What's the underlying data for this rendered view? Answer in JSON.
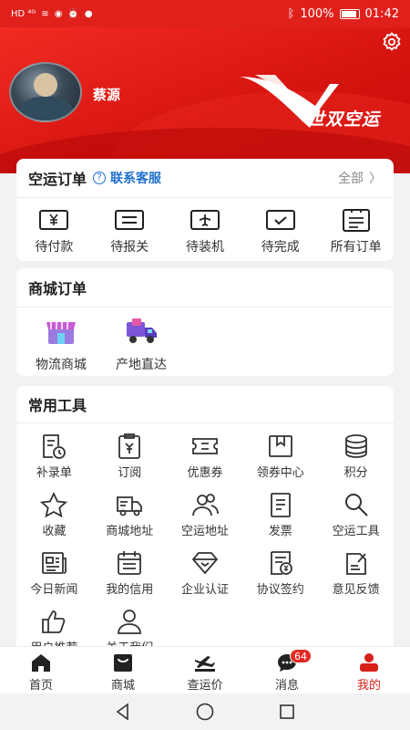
{
  "status_bar": {
    "left_icons": "HD ⁴ᴳ",
    "battery": "100%",
    "time": "01:42"
  },
  "profile": {
    "username": "蔡源",
    "brand_name": "世双空运"
  },
  "air_orders": {
    "title": "空运订单",
    "help_icon": "?",
    "service_link": "联系客服",
    "all_link": "全部",
    "items": [
      {
        "label": "待付款",
        "icon": "yen-card-icon"
      },
      {
        "label": "待报关",
        "icon": "document-icon"
      },
      {
        "label": "待装机",
        "icon": "plane-icon"
      },
      {
        "label": "待完成",
        "icon": "check-box-icon"
      },
      {
        "label": "所有订单",
        "icon": "list-icon"
      }
    ]
  },
  "mall_orders": {
    "title": "商城订单",
    "items": [
      {
        "label": "物流商城",
        "icon": "store-icon"
      },
      {
        "label": "产地直达",
        "icon": "truck-icon"
      }
    ]
  },
  "tools": {
    "title": "常用工具",
    "items": [
      {
        "label": "补录单",
        "icon": "form-clock-icon"
      },
      {
        "label": "订阅",
        "icon": "clipboard-yen-icon"
      },
      {
        "label": "优惠券",
        "icon": "coupon-icon"
      },
      {
        "label": "领券中心",
        "icon": "box-icon"
      },
      {
        "label": "积分",
        "icon": "coins-icon"
      },
      {
        "label": "收藏",
        "icon": "star-icon"
      },
      {
        "label": "商城地址",
        "icon": "truck-outline-icon"
      },
      {
        "label": "空运地址",
        "icon": "people-icon"
      },
      {
        "label": "发票",
        "icon": "invoice-icon"
      },
      {
        "label": "空运工具",
        "icon": "search-icon"
      },
      {
        "label": "今日新闻",
        "icon": "news-icon"
      },
      {
        "label": "我的信用",
        "icon": "calendar-icon"
      },
      {
        "label": "企业认证",
        "icon": "diamond-icon"
      },
      {
        "label": "协议签约",
        "icon": "contract-icon"
      },
      {
        "label": "意见反馈",
        "icon": "feedback-icon"
      },
      {
        "label": "用户推荐",
        "icon": "thumbs-up-icon"
      },
      {
        "label": "关于我们",
        "icon": "user-icon"
      }
    ]
  },
  "tab_bar": {
    "items": [
      {
        "label": "首页",
        "icon": "home-icon"
      },
      {
        "label": "商城",
        "icon": "shopping-bag-icon"
      },
      {
        "label": "查运价",
        "icon": "airplane-freight-icon"
      },
      {
        "label": "消息",
        "icon": "chat-icon",
        "badge": "64"
      },
      {
        "label": "我的",
        "icon": "profile-icon",
        "active": true
      }
    ]
  },
  "colors": {
    "primary": "#e0201b",
    "link": "#1f6fcf"
  }
}
